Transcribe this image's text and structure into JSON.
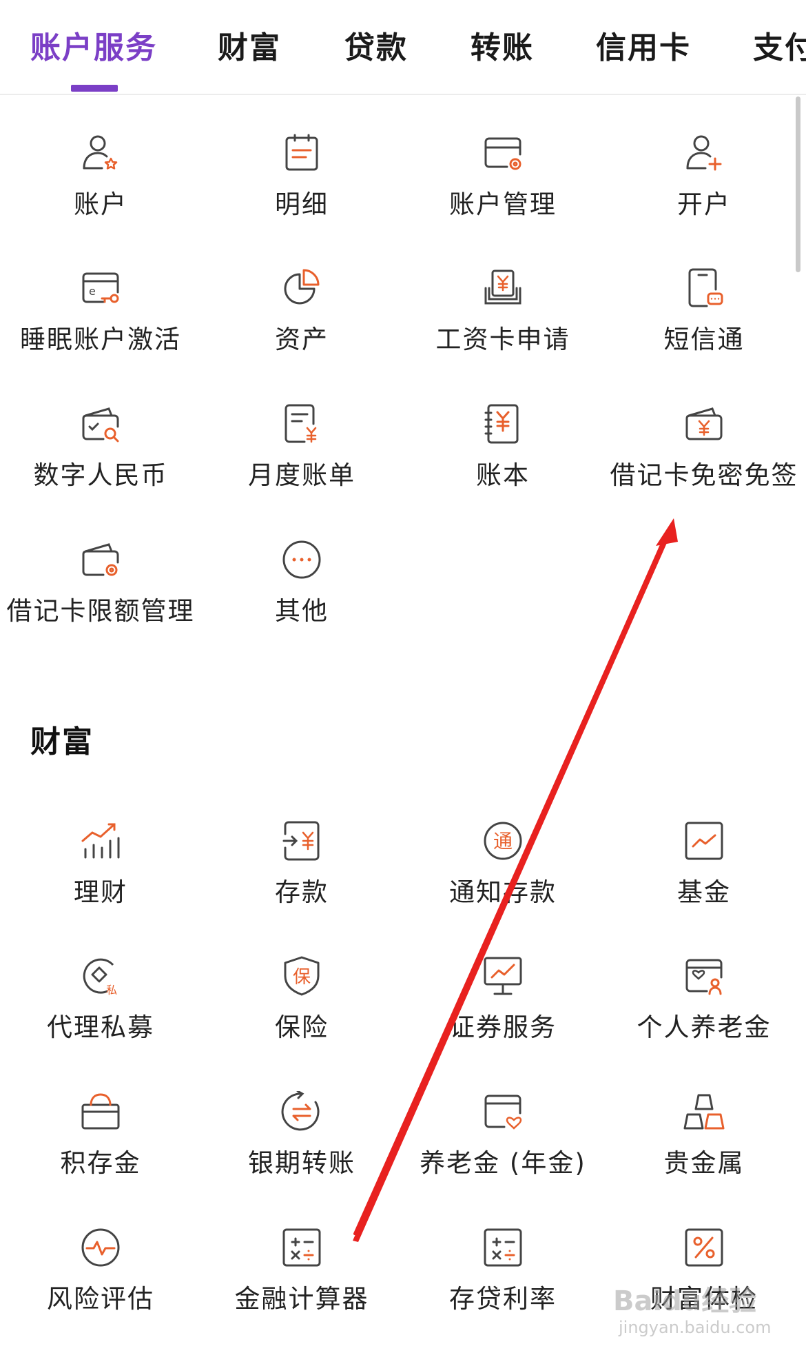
{
  "tabs": [
    {
      "label": "账户服务",
      "active": true
    },
    {
      "label": "财富",
      "active": false
    },
    {
      "label": "贷款",
      "active": false
    },
    {
      "label": "转账",
      "active": false
    },
    {
      "label": "信用卡",
      "active": false
    },
    {
      "label": "支付",
      "active": false
    }
  ],
  "account_services": {
    "items": [
      {
        "label": "账户",
        "icon": "user-star-icon"
      },
      {
        "label": "明细",
        "icon": "calendar-list-icon"
      },
      {
        "label": "账户管理",
        "icon": "card-gear-icon"
      },
      {
        "label": "开户",
        "icon": "user-plus-icon"
      },
      {
        "label": "睡眠账户激活",
        "icon": "card-key-icon"
      },
      {
        "label": "资产",
        "icon": "pie-chart-icon"
      },
      {
        "label": "工资卡申请",
        "icon": "salary-card-icon"
      },
      {
        "label": "短信通",
        "icon": "phone-message-icon"
      },
      {
        "label": "数字人民币",
        "icon": "wallet-search-icon"
      },
      {
        "label": "月度账单",
        "icon": "bill-yuan-icon"
      },
      {
        "label": "账本",
        "icon": "ledger-yuan-icon"
      },
      {
        "label": "借记卡免密免签",
        "icon": "wallet-yuan-icon"
      },
      {
        "label": "借记卡限额管理",
        "icon": "wallet-gear-icon"
      },
      {
        "label": "其他",
        "icon": "more-dots-icon"
      }
    ]
  },
  "wealth": {
    "title": "财富",
    "items": [
      {
        "label": "理财",
        "icon": "growth-chart-icon"
      },
      {
        "label": "存款",
        "icon": "deposit-arrow-icon"
      },
      {
        "label": "通知存款",
        "icon": "notice-circle-icon"
      },
      {
        "label": "基金",
        "icon": "fund-chart-icon"
      },
      {
        "label": "代理私募",
        "icon": "private-diamond-icon"
      },
      {
        "label": "保险",
        "icon": "shield-insurance-icon"
      },
      {
        "label": "证券服务",
        "icon": "monitor-chart-icon"
      },
      {
        "label": "个人养老金",
        "icon": "pension-card-icon"
      },
      {
        "label": "积存金",
        "icon": "gold-box-icon"
      },
      {
        "label": "银期转账",
        "icon": "exchange-circle-icon"
      },
      {
        "label": "养老金 (年金)",
        "icon": "annuity-card-icon"
      },
      {
        "label": "贵金属",
        "icon": "gold-bars-icon"
      },
      {
        "label": "风险评估",
        "icon": "pulse-circle-icon"
      },
      {
        "label": "金融计算器",
        "icon": "calculator-icon"
      },
      {
        "label": "存贷利率",
        "icon": "rate-calculator-icon"
      },
      {
        "label": "财富体检",
        "icon": "percent-box-icon"
      }
    ]
  },
  "watermark": {
    "text": "Baidu经验",
    "sub": "jingyan.baidu.com"
  },
  "colors": {
    "accent": "#7b3fc6",
    "icon_orange": "#e8602c",
    "icon_gray": "#444444",
    "annotation": "#e8211f"
  }
}
